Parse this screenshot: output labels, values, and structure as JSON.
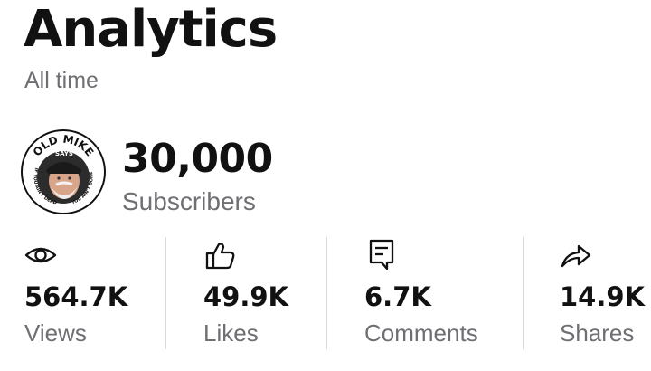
{
  "header": {
    "title": "Analytics",
    "subtitle": "All time"
  },
  "channel": {
    "avatar_texts": [
      "OLD MIKE",
      "SAYS",
      "IF YOU AIN'T DEAD",
      "YOU AIN'T DONE"
    ],
    "subscriber_count": "30,000",
    "subscriber_label": "Subscribers"
  },
  "stats": [
    {
      "icon": "eye-icon",
      "value": "564.7K",
      "label": "Views"
    },
    {
      "icon": "thumbs-up-icon",
      "value": "49.9K",
      "label": "Likes"
    },
    {
      "icon": "comment-icon",
      "value": "6.7K",
      "label": "Comments"
    },
    {
      "icon": "share-icon",
      "value": "14.9K",
      "label": "Shares"
    }
  ],
  "colors": {
    "primary_text": "#111111",
    "secondary_text": "#6e6e73",
    "divider": "#d9d9dc"
  }
}
